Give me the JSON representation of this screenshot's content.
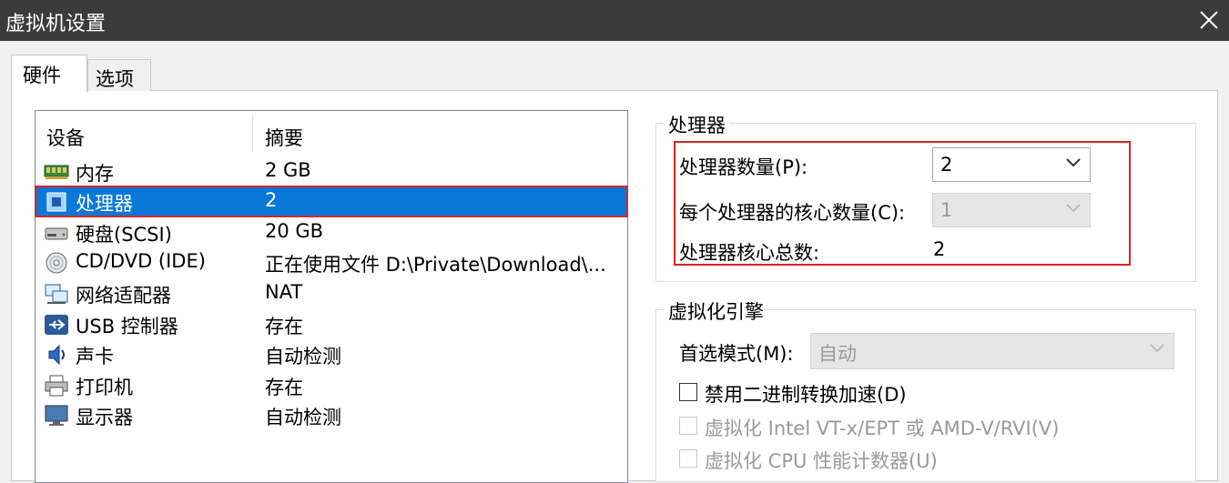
{
  "window": {
    "title": "虚拟机设置"
  },
  "tabs": [
    {
      "label": "硬件"
    },
    {
      "label": "选项"
    }
  ],
  "device_list": {
    "columns": {
      "device": "设备",
      "summary": "摘要"
    },
    "rows": [
      {
        "name": "内存",
        "summary": "2 GB",
        "icon": "memory-icon"
      },
      {
        "name": "处理器",
        "summary": "2",
        "icon": "processor-icon"
      },
      {
        "name": "硬盘(SCSI)",
        "summary": "20 GB",
        "icon": "hard-disk-icon"
      },
      {
        "name": "CD/DVD (IDE)",
        "summary": "正在使用文件 D:\\Private\\Download\\...",
        "icon": "cd-dvd-icon"
      },
      {
        "name": "网络适配器",
        "summary": "NAT",
        "icon": "network-adapter-icon"
      },
      {
        "name": "USB 控制器",
        "summary": "存在",
        "icon": "usb-icon"
      },
      {
        "name": "声卡",
        "summary": "自动检测",
        "icon": "sound-card-icon"
      },
      {
        "name": "打印机",
        "summary": "存在",
        "icon": "printer-icon"
      },
      {
        "name": "显示器",
        "summary": "自动检测",
        "icon": "display-icon"
      }
    ]
  },
  "processors": {
    "group_title": "处理器",
    "count_label": "处理器数量(P):",
    "count_value": "2",
    "cores_label": "每个处理器的核心数量(C):",
    "cores_value": "1",
    "total_label": "处理器核心总数:",
    "total_value": "2"
  },
  "virtualization": {
    "group_title": "虚拟化引擎",
    "mode_label": "首选模式(M):",
    "mode_value": "自动",
    "options": [
      {
        "label": "禁用二进制转换加速(D)",
        "checked": false,
        "enabled": true
      },
      {
        "label": "虚拟化 Intel VT-x/EPT 或 AMD-V/RVI(V)",
        "checked": false,
        "enabled": false
      },
      {
        "label": "虚拟化 CPU 性能计数器(U)",
        "checked": false,
        "enabled": false
      }
    ]
  },
  "colors": {
    "selection": "#0a78d7",
    "highlight_box": "#e02020",
    "titlebar": "#3b3b3b"
  }
}
